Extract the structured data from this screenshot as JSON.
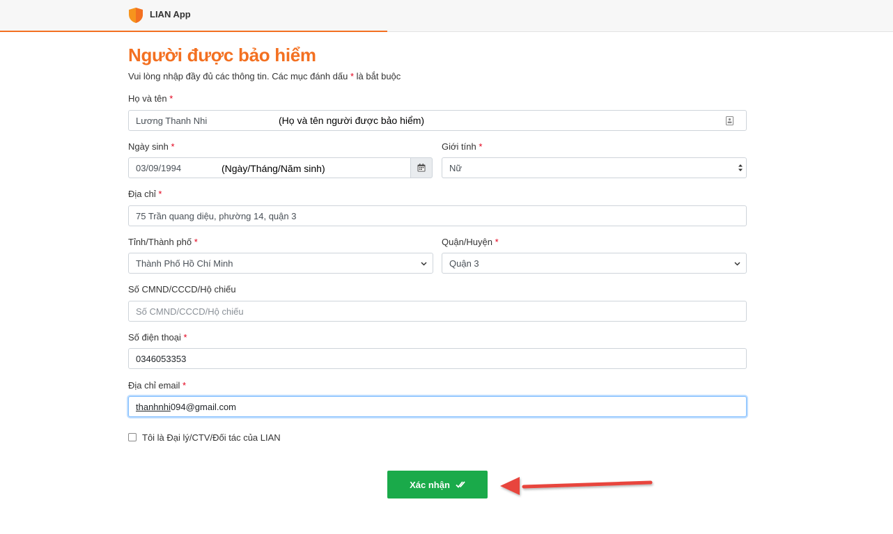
{
  "app": {
    "title": "LIAN App",
    "accent_color": "#f37021"
  },
  "page": {
    "title": "Người được bảo hiểm",
    "subtitle": "Vui lòng nhập đầy đủ các thông tin. Các mục đánh dấu",
    "subtitle_required_mark": "*",
    "subtitle_end": "là bắt buộc"
  },
  "form": {
    "required_mark": "*",
    "full_name": {
      "label": "Họ và tên",
      "value": "Lương Thanh Nhi",
      "annotation": "(Họ và tên người được bảo hiểm)",
      "icon": "contact-card-icon"
    },
    "dob": {
      "label": "Ngày sinh",
      "value": "03/09/1994",
      "annotation": "(Ngày/Tháng/Năm sinh)",
      "icon": "calendar-icon"
    },
    "gender": {
      "label": "Giới tính",
      "value": "Nữ"
    },
    "address": {
      "label": "Địa chỉ",
      "value": "75 Trần quang diệu, phường 14, quận 3"
    },
    "province": {
      "label": "Tỉnh/Thành phố",
      "value": "Thành Phố Hồ Chí Minh"
    },
    "district": {
      "label": "Quận/Huyện",
      "value": "Quận 3"
    },
    "id_number": {
      "label": "Số CMND/CCCD/Hộ chiếu",
      "placeholder": "Số CMND/CCCD/Hộ chiếu"
    },
    "phone": {
      "label": "Số điện thoại",
      "value": "0346053353"
    },
    "email": {
      "label": "Địa chỉ email",
      "value_underlined": "thanhnhi",
      "value_rest": "094@gmail.com"
    },
    "agent_checkbox": {
      "label": "Tôi là Đại lý/CTV/Đối tác của LIAN",
      "checked": false
    },
    "submit": {
      "label": "Xác nhận",
      "color": "#1aaa4a"
    }
  }
}
